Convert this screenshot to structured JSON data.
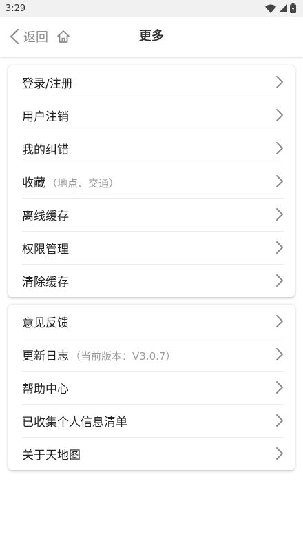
{
  "status_bar": {
    "time": "3:29"
  },
  "header": {
    "back_label": "返回",
    "title": "更多"
  },
  "groups": [
    {
      "items": [
        {
          "label": "登录/注册"
        },
        {
          "label": "用户注销"
        },
        {
          "label": "我的纠错"
        },
        {
          "label": "收藏",
          "sub": "（地点、交通）"
        },
        {
          "label": "离线缓存"
        },
        {
          "label": "权限管理"
        },
        {
          "label": "清除缓存"
        }
      ]
    },
    {
      "items": [
        {
          "label": "意见反馈"
        },
        {
          "label": "更新日志",
          "sub": "（当前版本：V3.0.7）"
        },
        {
          "label": "帮助中心"
        },
        {
          "label": "已收集个人信息清单"
        },
        {
          "label": "关于天地图"
        }
      ]
    }
  ],
  "colors": {
    "chevron": "#8c8c8c",
    "subtext": "#9a9a9a",
    "divider": "#ececec"
  },
  "icons": {
    "back": "chevron-left-icon",
    "home": "home-icon",
    "item_arrow": "chevron-right-icon"
  }
}
